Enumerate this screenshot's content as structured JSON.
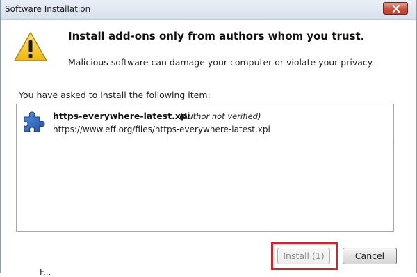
{
  "window": {
    "title": "Software Installation"
  },
  "dialog": {
    "heading": "Install add-ons only from authors whom you trust.",
    "message": "Malicious software can damage your computer or violate your privacy.",
    "list_label": "You have asked to install the following item:",
    "items": [
      {
        "name": "https-everywhere-latest.xpi",
        "author_note": "(Author not verified)",
        "url": "https://www.eff.org/files/https-everywhere-latest.xpi",
        "icon": "puzzle-piece-icon"
      }
    ]
  },
  "buttons": {
    "install_label": "Install (1)",
    "install_disabled": true,
    "cancel_label": "Cancel"
  },
  "annotation": {
    "highlight_color": "#d3232a"
  },
  "footer": {
    "partial_text": "F..."
  },
  "colors": {
    "warning_yellow": "#f3c623",
    "puzzle_blue": "#2f6bc4",
    "close_red": "#c7523f"
  }
}
